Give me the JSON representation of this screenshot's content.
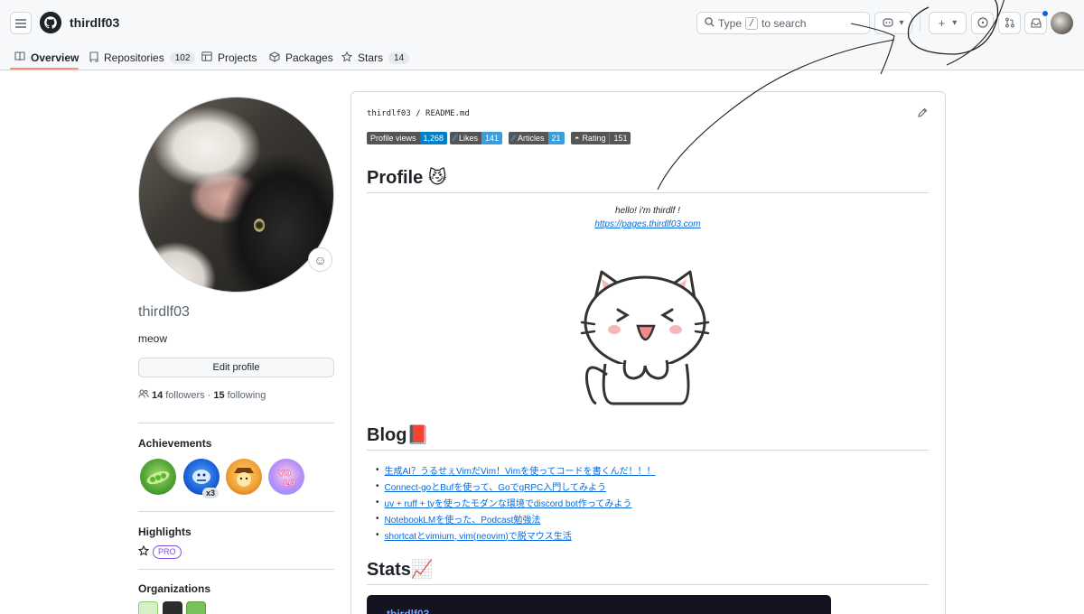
{
  "header": {
    "username": "thirdlf03",
    "search": {
      "prefix": "Type",
      "key": "/",
      "suffix": "to search"
    }
  },
  "tabs": [
    {
      "label": "Overview",
      "count": ""
    },
    {
      "label": "Repositories",
      "count": "102"
    },
    {
      "label": "Projects",
      "count": ""
    },
    {
      "label": "Packages",
      "count": ""
    },
    {
      "label": "Stars",
      "count": "14"
    }
  ],
  "profile": {
    "name": "thirdlf03",
    "bio": "meow",
    "edit_label": "Edit profile",
    "followers": "14",
    "followers_label": "followers",
    "separator": "·",
    "following": "15",
    "following_label": "following"
  },
  "achievements": {
    "title": "Achievements",
    "multiplier": "x3"
  },
  "highlights": {
    "title": "Highlights",
    "pro": "PRO"
  },
  "organizations": {
    "title": "Organizations"
  },
  "readme": {
    "owner": "thirdlf03",
    "sep": "/",
    "file": "README.md",
    "badges": [
      {
        "label": "Profile views",
        "value": "1,268",
        "color": "#007ec6"
      },
      {
        "label": "Likes",
        "value": "141",
        "color": "#3b9ddc"
      },
      {
        "label": "Articles",
        "value": "21",
        "color": "#3b9ddc"
      },
      {
        "label": "Rating",
        "value": "151",
        "color": "#555555"
      }
    ],
    "profile_heading": "Profile 😼",
    "hello": "hello! i'm thirdlf !",
    "site": "https://pages.thirdlf03.com",
    "blog_heading": "Blog📕",
    "blog_posts": [
      "生成AI？うるせぇVimだVim！Vimを使ってコードを書くんだ！！！",
      "Connect-goとBufを使って、GoでgRPC入門してみよう",
      "uv + ruff + tyを使ったモダンな環境でdiscord bot作ってみよう",
      "NotebookLMを使った、Podcast勉強法",
      "shortcatとvimium, vim(neovim)で脱マウス生活"
    ],
    "stats_heading": "Stats📈",
    "stats_card_title": "thirdlf03"
  },
  "colors": {
    "accent": "#0969da",
    "tab_underline": "#fd8c73",
    "pro": "#8250df"
  }
}
